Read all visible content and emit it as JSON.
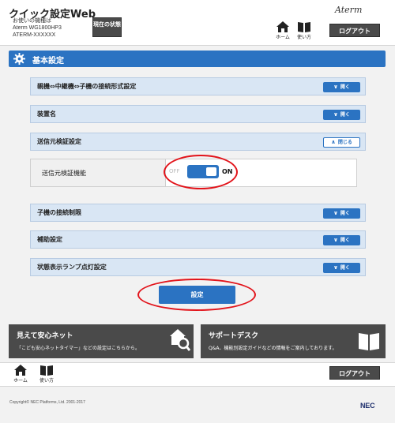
{
  "header": {
    "app_title": "クイック設定Web",
    "device_label": "お使いの機種は",
    "device_model": "Aterm WG1800HP3",
    "device_name": "ATERM-XXXXXX",
    "status_button": "現在の状態",
    "brand": "Aterm",
    "home_label": "ホーム",
    "manual_label": "使い方",
    "logout_label": "ログアウト"
  },
  "section": {
    "title": "基本設定"
  },
  "panels": [
    {
      "label": "親機⇔中継機⇔子機の接続形式設定",
      "button": "開く",
      "state": "collapsed"
    },
    {
      "label": "装置名",
      "button": "開く",
      "state": "collapsed"
    },
    {
      "label": "送信元検証設定",
      "button": "閉じる",
      "state": "expanded"
    },
    {
      "label": "子機の接続制限",
      "button": "開く",
      "state": "collapsed"
    },
    {
      "label": "補助設定",
      "button": "開く",
      "state": "collapsed"
    },
    {
      "label": "状態表示ランプ点灯設定",
      "button": "開く",
      "state": "collapsed"
    }
  ],
  "source_verification": {
    "label": "送信元検証機能",
    "switch_off_label": "OFF",
    "switch_on_label": "ON",
    "value": "ON"
  },
  "submit_label": "設定",
  "promos": [
    {
      "title": "見えて安心ネット",
      "desc": "「こども安心ネットタイマー」などの設定はこちらから。",
      "icon": "house-search-icon"
    },
    {
      "title": "サポートデスク",
      "desc": "Q&A、機能別設定ガイドなどの情報をご案内しております。",
      "icon": "book-icon"
    }
  ],
  "footer": {
    "home_label": "ホーム",
    "manual_label": "使い方",
    "logout_label": "ログアウト",
    "copyright": "Copyright© NEC Platforms, Ltd. 2001-2017",
    "brand": "NEC"
  },
  "colors": {
    "accent": "#2b73c2",
    "panel_bg": "#d9e6f4",
    "highlight": "#e2131a",
    "dark_button": "#4a4a4a"
  }
}
